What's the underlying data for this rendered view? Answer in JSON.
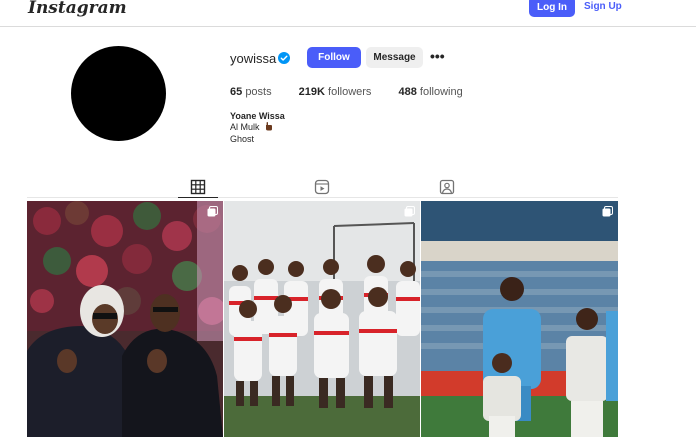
{
  "header": {
    "logo_text": "Instagram",
    "login_label": "Log In",
    "signup_label": "Sign Up"
  },
  "profile": {
    "username": "yowissa",
    "verified": true,
    "follow_label": "Follow",
    "message_label": "Message",
    "more_glyph": "•••",
    "stats": {
      "posts_count": "65",
      "posts_label": "posts",
      "followers_count": "219K",
      "followers_label": "followers",
      "following_count": "488",
      "following_label": "following"
    },
    "full_name": "Yoane Wissa",
    "bio_line1": "Al Mulk",
    "bio_line2": "Ghost"
  },
  "tabs": [
    {
      "name": "posts",
      "icon": "grid-icon",
      "active": true
    },
    {
      "name": "reels",
      "icon": "reels-icon",
      "active": false
    },
    {
      "name": "tagged",
      "icon": "tagged-icon",
      "active": false
    }
  ],
  "posts": [
    {
      "type": "photo",
      "icon": "multi-post-icon",
      "scene": "two men in black posing in front of flower wall"
    },
    {
      "type": "photo",
      "icon": "multi-post-icon",
      "scene": "football team lineup photo in white kits"
    },
    {
      "type": "photo",
      "icon": "multi-post-icon",
      "scene": "player in blue kit with mascot children in stadium"
    }
  ],
  "colors": {
    "accent": "#4a5df9",
    "verified": "#0095f6",
    "text": "#262626",
    "border": "#dbdbdb"
  }
}
